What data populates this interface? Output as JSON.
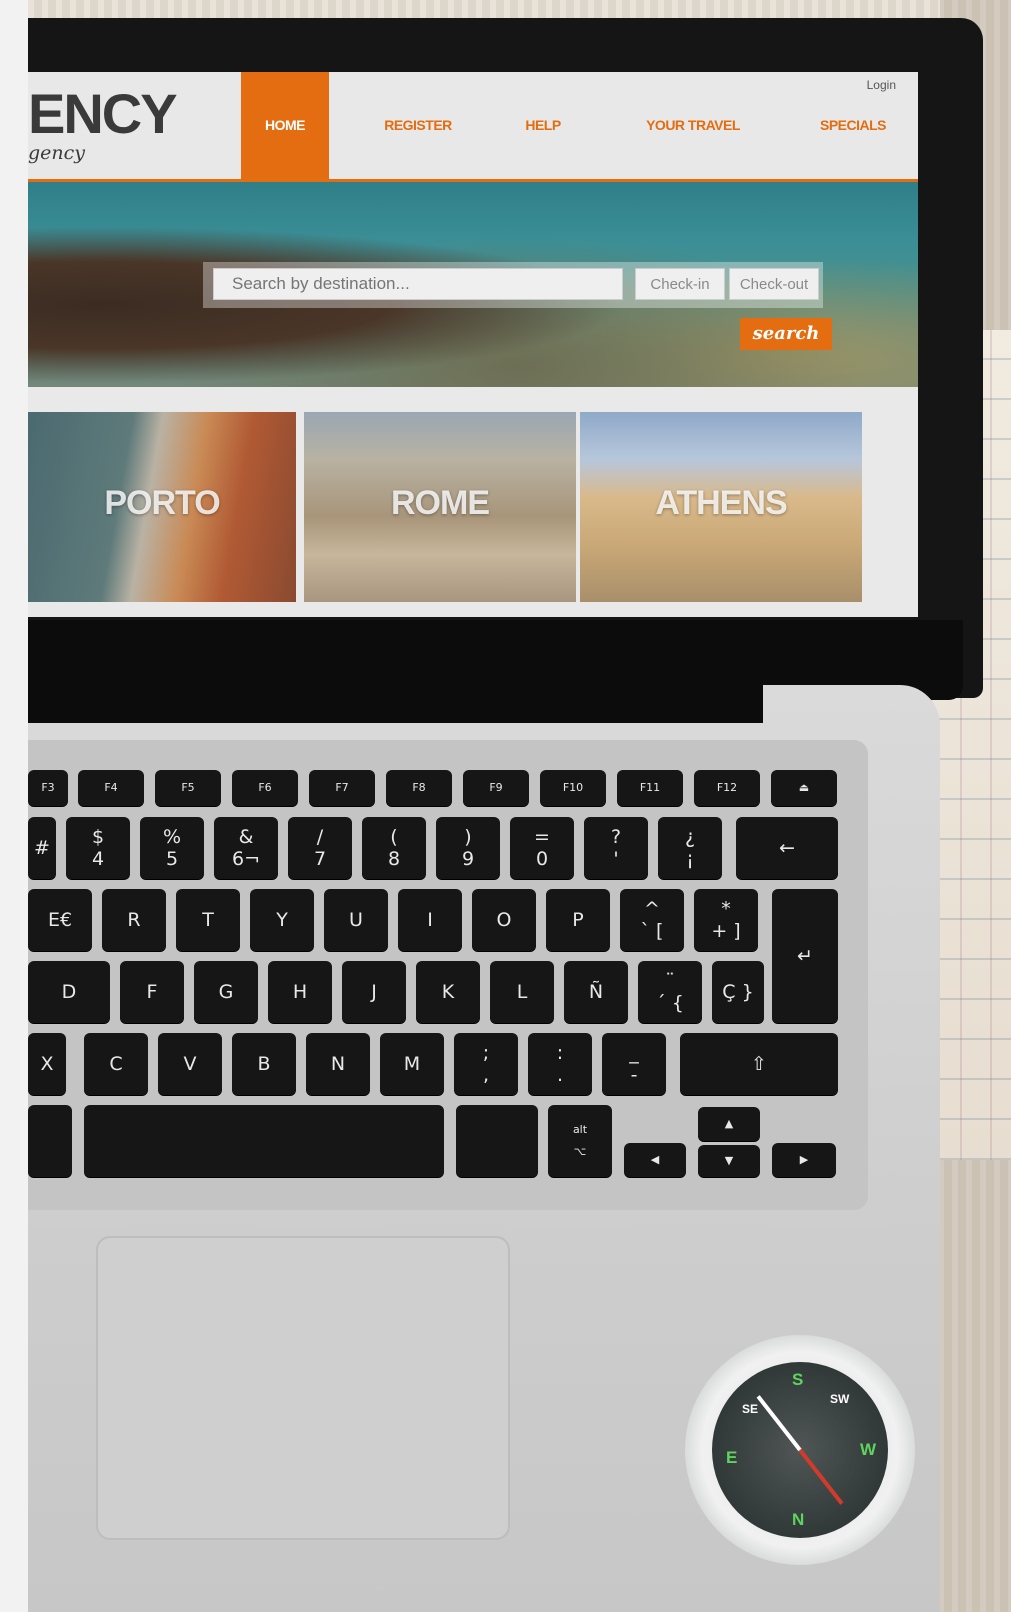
{
  "site": {
    "logo": "ENCY",
    "tagline": "gency",
    "login": "Login",
    "nav": [
      {
        "label": "HOME",
        "active": true
      },
      {
        "label": "REGISTER",
        "active": false
      },
      {
        "label": "HELP",
        "active": false
      },
      {
        "label": "YOUR TRAVEL",
        "active": false
      },
      {
        "label": "SPECIALS",
        "active": false
      }
    ],
    "search": {
      "placeholder": "Search by destination...",
      "check_in": "Check-in",
      "check_out": "Check-out",
      "button": "search"
    },
    "destinations": [
      "PORTO",
      "ROME",
      "ATHENS"
    ]
  },
  "keyboard": {
    "fn_row": [
      "F3",
      "F4",
      "F5",
      "F6",
      "F7",
      "F8",
      "F9",
      "F10",
      "F11",
      "F12",
      "⏏"
    ],
    "number_row": [
      "#",
      "$\n4",
      "%\n5",
      "&\n6¬",
      "/\n7",
      "(\n8",
      ")\n9",
      "=\n0",
      "?\n'",
      "¿\n¡",
      "←"
    ],
    "top_row": [
      "E€",
      "R",
      "T",
      "Y",
      "U",
      "I",
      "O",
      "P",
      "^\n` [",
      "*\n+ ]",
      "↵"
    ],
    "home_row": [
      "D",
      "F",
      "G",
      "H",
      "J",
      "K",
      "L",
      "Ñ",
      "¨\n´ {",
      "Ç }"
    ],
    "bottom_row": [
      "X",
      "C",
      "V",
      "B",
      "N",
      "M",
      ";\n,",
      ":\n.",
      "_\n-",
      "⇧"
    ],
    "space_row": [
      "alt\n⌥",
      "◀",
      "▲",
      "▼",
      "▶"
    ]
  },
  "compass": {
    "n": "N",
    "s": "S",
    "e": "E",
    "w": "W",
    "sw": "SW",
    "se": "SE"
  },
  "colors": {
    "accent": "#e36d10"
  }
}
